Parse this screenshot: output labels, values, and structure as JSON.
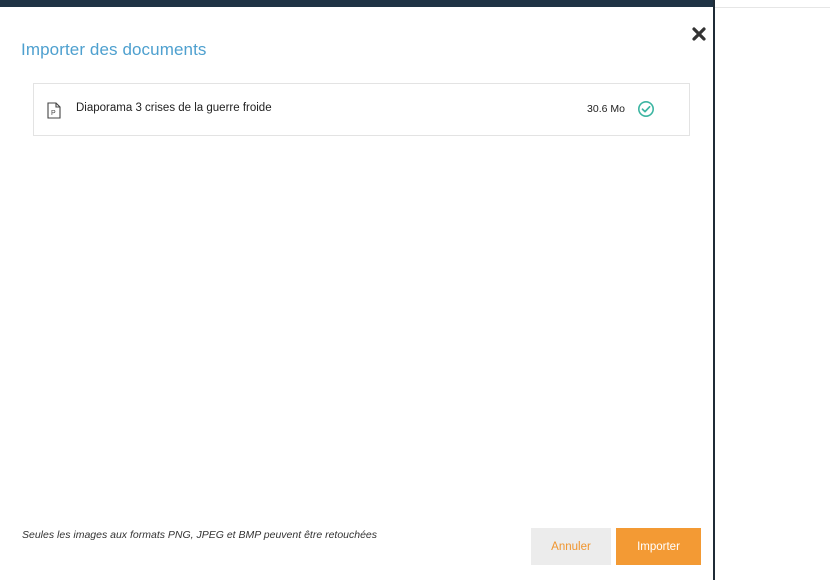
{
  "dialog": {
    "title": "Importer des documents",
    "close_icon": "close-icon"
  },
  "files": [
    {
      "icon": "presentation-file-icon",
      "name": "Diaporama 3 crises de la guerre froide",
      "size": "30.6 Mo",
      "status_icon": "check-circle-icon"
    }
  ],
  "footer": {
    "note": "Seules les images aux formats PNG, JPEG et BMP peuvent être retouchées",
    "cancel_label": "Annuler",
    "import_label": "Importer"
  },
  "colors": {
    "title": "#4ea0cf",
    "accent": "#f39a34",
    "success": "#3cb5a2",
    "topbar": "#1f3345"
  }
}
